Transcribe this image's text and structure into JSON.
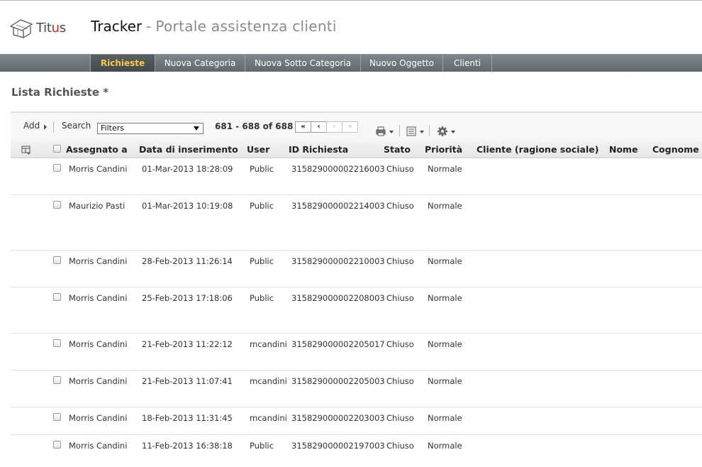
{
  "brand": {
    "logo_text_main": "Tit",
    "logo_text_accent": "u",
    "logo_text_end": "s",
    "app_name": "Tracker",
    "app_separator": "-",
    "app_subtitle": "Portale assistenza clienti",
    "accent_color": "#f7c948"
  },
  "nav": {
    "items": [
      {
        "label": "Richieste",
        "active": true
      },
      {
        "label": "Nuova Categoria",
        "active": false
      },
      {
        "label": "Nuova Sotto Categoria",
        "active": false
      },
      {
        "label": "Nuovo Oggetto",
        "active": false
      },
      {
        "label": "Clienti",
        "active": false
      }
    ]
  },
  "page": {
    "title": "Lista Richieste *"
  },
  "toolbar": {
    "add_label": "Add",
    "search_label": "Search",
    "filter_value": "Filters",
    "record_range": "681 - 688 of 688",
    "pager": {
      "first": "«",
      "prev": "‹",
      "next": "›",
      "last": "»"
    },
    "icons": [
      "print-icon",
      "list-icon",
      "gear-icon"
    ]
  },
  "table": {
    "columns": [
      "Assegnato a",
      "Data di inserimento",
      "User",
      "ID Richiesta",
      "Stato",
      "Priorità",
      "Cliente (ragione sociale)",
      "Nome",
      "Cognome"
    ],
    "rows": [
      {
        "assegnato": "Morris Candini",
        "data": "01-Mar-2013 18:28:09",
        "user": "Public",
        "id": "315829000002216003",
        "stato": "Chiuso",
        "priorita": "Normale"
      },
      {
        "assegnato": "Maurizio Pasti",
        "data": "01-Mar-2013 10:19:08",
        "user": "Public",
        "id": "315829000002214003",
        "stato": "Chiuso",
        "priorita": "Normale"
      },
      {
        "assegnato": "Morris Candini",
        "data": "28-Feb-2013 11:26:14",
        "user": "Public",
        "id": "315829000002210003",
        "stato": "Chiuso",
        "priorita": "Normale"
      },
      {
        "assegnato": "Morris Candini",
        "data": "25-Feb-2013 17:18:06",
        "user": "Public",
        "id": "315829000002208003",
        "stato": "Chiuso",
        "priorita": "Normale"
      },
      {
        "assegnato": "Morris Candini",
        "data": "21-Feb-2013 11:22:12",
        "user": "mcandini",
        "id": "315829000002205017",
        "stato": "Chiuso",
        "priorita": "Normale"
      },
      {
        "assegnato": "Morris Candini",
        "data": "21-Feb-2013 11:07:41",
        "user": "mcandini",
        "id": "315829000002205003",
        "stato": "Chiuso",
        "priorita": "Normale"
      },
      {
        "assegnato": "Morris Candini",
        "data": "18-Feb-2013 11:31:45",
        "user": "mcandini",
        "id": "315829000002203003",
        "stato": "Chiuso",
        "priorita": "Normale"
      },
      {
        "assegnato": "Morris Candini",
        "data": "11-Feb-2013 16:38:18",
        "user": "Public",
        "id": "315829000002197003",
        "stato": "Chiuso",
        "priorita": "Normale"
      }
    ]
  }
}
